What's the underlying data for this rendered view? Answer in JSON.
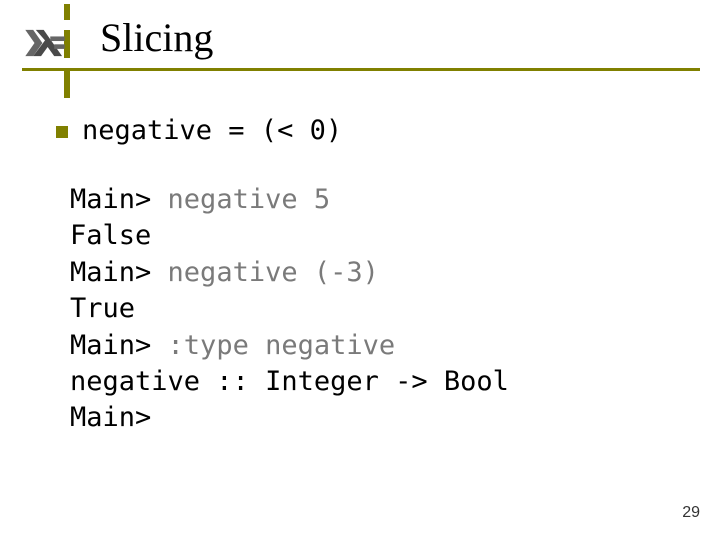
{
  "header": {
    "title": "Slicing"
  },
  "definition": {
    "text": "negative = (< 0)"
  },
  "repl": {
    "l1_prompt": "Main> ",
    "l1_cmd": "negative 5",
    "l2": "False",
    "l3_prompt": "Main> ",
    "l3_cmd": "negative (-3)",
    "l4": "True",
    "l5_prompt": "Main> ",
    "l5_cmd": ":type negative",
    "l6": "negative :: Integer -> Bool",
    "l7": "Main>"
  },
  "page_number": "29",
  "icons": {
    "haskell_logo": "haskell-logo"
  }
}
